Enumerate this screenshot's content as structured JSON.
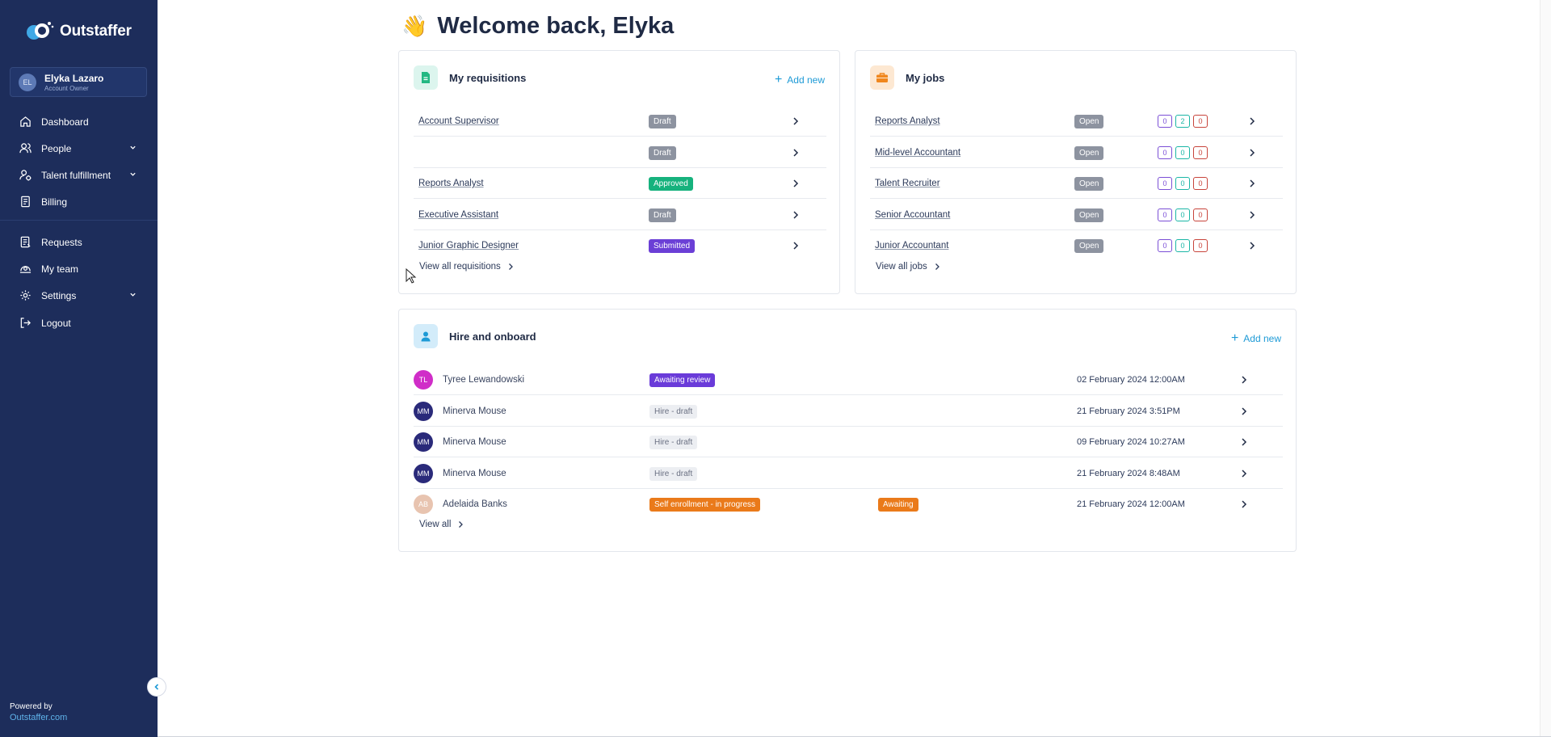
{
  "brand": {
    "name": "Outstaffer"
  },
  "user": {
    "initials": "EL",
    "name": "Elyka Lazaro",
    "role": "Account Owner"
  },
  "nav": {
    "dashboard": "Dashboard",
    "people": "People",
    "talent": "Talent fulfillment",
    "billing": "Billing",
    "requests": "Requests",
    "my_team": "My team",
    "settings": "Settings",
    "logout": "Logout"
  },
  "footer": {
    "powered_by": "Powered by",
    "link": "Outstaffer.com"
  },
  "welcome": {
    "emoji": "👋",
    "title": "Welcome back, Elyka"
  },
  "requisitions": {
    "title": "My requisitions",
    "add_new": "Add new",
    "view_all": "View all requisitions",
    "rows": [
      {
        "name": "Account Supervisor",
        "status": "Draft"
      },
      {
        "name": "",
        "status": "Draft"
      },
      {
        "name": "Reports Analyst",
        "status": "Approved"
      },
      {
        "name": "Executive Assistant",
        "status": "Draft"
      },
      {
        "name": "Junior Graphic Designer",
        "status": "Submitted"
      }
    ]
  },
  "jobs": {
    "title": "My jobs",
    "view_all": "View all jobs",
    "rows": [
      {
        "name": "Reports Analyst",
        "status": "Open",
        "counts": [
          "0",
          "2",
          "0"
        ]
      },
      {
        "name": "Mid-level Accountant",
        "status": "Open",
        "counts": [
          "0",
          "0",
          "0"
        ]
      },
      {
        "name": "Talent Recruiter",
        "status": "Open",
        "counts": [
          "0",
          "0",
          "0"
        ]
      },
      {
        "name": "Senior Accountant",
        "status": "Open",
        "counts": [
          "0",
          "0",
          "0"
        ]
      },
      {
        "name": "Junior Accountant",
        "status": "Open",
        "counts": [
          "0",
          "0",
          "0"
        ]
      }
    ]
  },
  "hire": {
    "title": "Hire and onboard",
    "add_new": "Add new",
    "view_all": "View all",
    "rows": [
      {
        "initials": "TL",
        "name": "Tyree Lewandowski",
        "status": "Awaiting review",
        "extra": "",
        "date": "02 February 2024 12:00AM",
        "avatar_color": "#d02dc8"
      },
      {
        "initials": "MM",
        "name": "Minerva Mouse",
        "status": "Hire - draft",
        "extra": "",
        "date": "21 February 2024 3:51PM",
        "avatar_color": "#2a2a7a"
      },
      {
        "initials": "MM",
        "name": "Minerva Mouse",
        "status": "Hire - draft",
        "extra": "",
        "date": "09 February 2024 10:27AM",
        "avatar_color": "#2a2a7a"
      },
      {
        "initials": "MM",
        "name": "Minerva Mouse",
        "status": "Hire - draft",
        "extra": "",
        "date": "21 February 2024 8:48AM",
        "avatar_color": "#2a2a7a"
      },
      {
        "initials": "AB",
        "name": "Adelaida Banks",
        "status": "Self enrollment - in progress",
        "extra": "Awaiting",
        "date": "21 February 2024 12:00AM",
        "avatar_color": "#e8c4b0"
      }
    ]
  }
}
